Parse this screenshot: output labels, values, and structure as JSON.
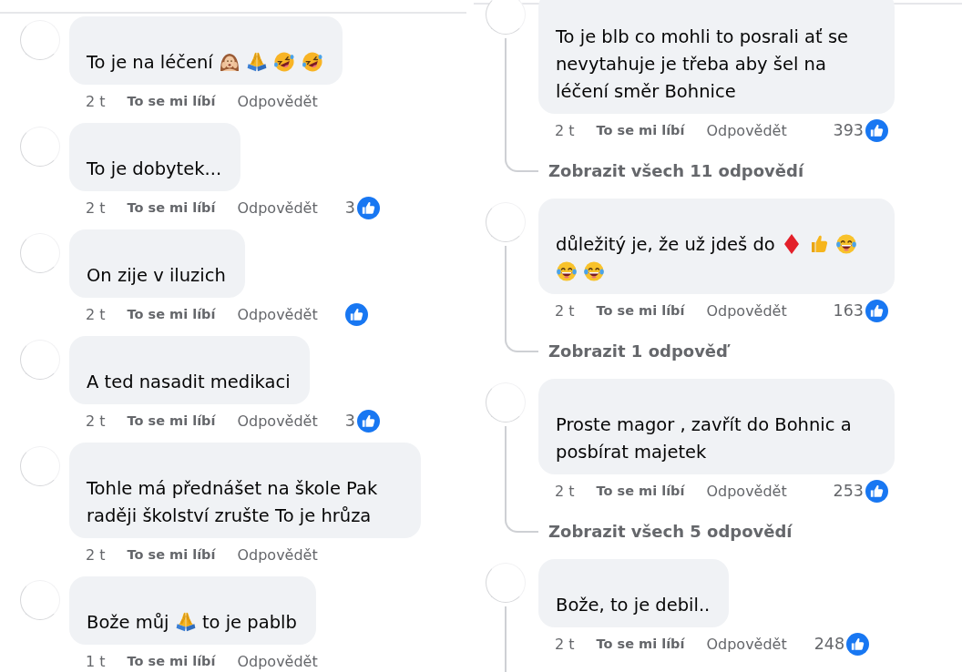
{
  "panels": [
    {
      "comments": [
        {
          "segments": [
            {
              "kind": "text",
              "text": "To je na léčení"
            },
            {
              "kind": "woman"
            },
            {
              "kind": "pray"
            },
            {
              "kind": "rofl"
            },
            {
              "kind": "rofl"
            }
          ],
          "time": "2 t",
          "like_action": "To se mi líbí",
          "reply_action": "Odpovědět",
          "reacted": false,
          "has_replies": false
        },
        {
          "segments": [
            {
              "kind": "text",
              "text": "To je dobytek..."
            }
          ],
          "time": "2 t",
          "like_action": "To se mi líbí",
          "reply_action": "Odpovědět",
          "reacted": true,
          "reaction_count": "3",
          "has_replies": false
        },
        {
          "segments": [
            {
              "kind": "text",
              "text": "On zije v iluzich"
            }
          ],
          "time": "2 t",
          "like_action": "To se mi líbí",
          "reply_action": "Odpovědět",
          "reacted": true,
          "has_replies": false
        },
        {
          "segments": [
            {
              "kind": "text",
              "text": "A ted nasadit medikaci"
            }
          ],
          "time": "2 t",
          "like_action": "To se mi líbí",
          "reply_action": "Odpovědět",
          "reacted": true,
          "reaction_count": "3",
          "has_replies": false
        },
        {
          "segments": [
            {
              "kind": "text",
              "text": "Tohle má přednášet na škole Pak raději školství zrušte To je hrůza"
            }
          ],
          "time": "2 t",
          "like_action": "To se mi líbí",
          "reply_action": "Odpovědět",
          "reacted": false,
          "has_replies": false
        },
        {
          "segments": [
            {
              "kind": "text",
              "text": "Bože můj"
            },
            {
              "kind": "pray"
            },
            {
              "kind": "text",
              "text": "to je pablb"
            }
          ],
          "time": "1 t",
          "like_action": "To se mi líbí",
          "reply_action": "Odpovědět",
          "reacted": false,
          "has_replies": false
        }
      ]
    },
    {
      "comments": [
        {
          "segments": [
            {
              "kind": "text",
              "text": "To je blb co mohli to posrali ať se nevytahuje je třeba aby šel na léčení směr Bohnice"
            }
          ],
          "time": "2 t",
          "like_action": "To se mi líbí",
          "reply_action": "Odpovědět",
          "reacted": true,
          "reaction_count": "393",
          "has_replies": true,
          "replies_link": "Zobrazit všech 11 odpovědí"
        },
        {
          "segments": [
            {
              "kind": "text",
              "text": "důležitý je, že už jdeš do"
            },
            {
              "kind": "diamond"
            },
            {
              "kind": "thumbsup"
            },
            {
              "kind": "joy"
            },
            {
              "kind": "joy"
            },
            {
              "kind": "joy"
            }
          ],
          "time": "2 t",
          "like_action": "To se mi líbí",
          "reply_action": "Odpovědět",
          "reacted": true,
          "reaction_count": "163",
          "has_replies": true,
          "replies_link": "Zobrazit 1 odpověď"
        },
        {
          "segments": [
            {
              "kind": "text",
              "text": "Proste magor , zavřít do Bohnic a posbírat majetek"
            }
          ],
          "time": "2 t",
          "like_action": "To se mi líbí",
          "reply_action": "Odpovědět",
          "reacted": true,
          "reaction_count": "253",
          "has_replies": true,
          "replies_link": "Zobrazit všech 5 odpovědí"
        },
        {
          "segments": [
            {
              "kind": "text",
              "text": "Bože, to je debil.."
            }
          ],
          "time": "2 t",
          "like_action": "To se mi líbí",
          "reply_action": "Odpovědět",
          "reacted": true,
          "reaction_count": "248",
          "has_replies": true
        }
      ]
    }
  ]
}
